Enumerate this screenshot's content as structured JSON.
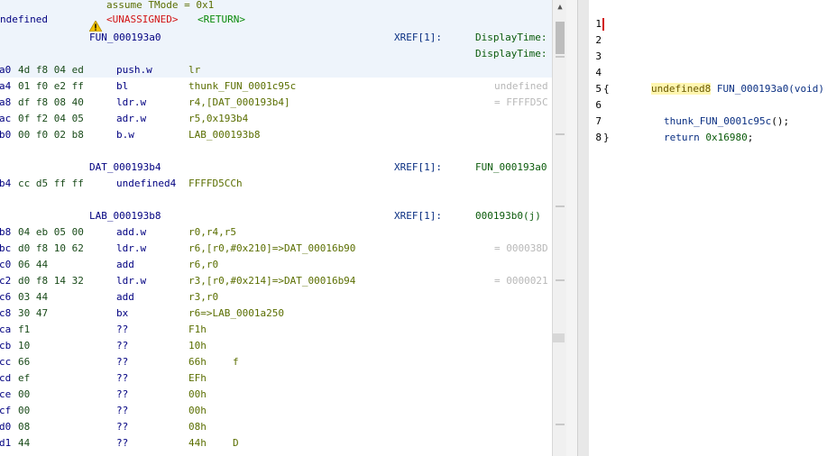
{
  "listing": {
    "header": {
      "truncated_label": "ndefined",
      "assume": "assume TMode = 0x1",
      "unassigned": "<UNASSIGNED>",
      "return": "<RETURN>",
      "func_name": "FUN_000193a0",
      "xref_label": "XREF[1]:",
      "xref_val1": "DisplayTime:",
      "xref_val2": "DisplayTime:"
    },
    "instructions": [
      {
        "addr": "a0",
        "bytes": "4d f8 04 ed",
        "mnem": "push.w",
        "ops": "lr",
        "comment": ""
      },
      {
        "addr": "a4",
        "bytes": "01 f0 e2 ff",
        "mnem": "bl",
        "ops": "thunk_FUN_0001c95c",
        "comment": "undefined"
      },
      {
        "addr": "a8",
        "bytes": "df f8 08 40",
        "mnem": "ldr.w",
        "ops": "r4,[DAT_000193b4]",
        "comment": "= FFFFD5C"
      },
      {
        "addr": "ac",
        "bytes": "0f f2 04 05",
        "mnem": "adr.w",
        "ops": "r5,0x193b4",
        "comment": ""
      },
      {
        "addr": "b0",
        "bytes": "00 f0 02 b8",
        "mnem": "b.w",
        "ops": "LAB_000193b8",
        "comment": ""
      }
    ],
    "dat_label": "DAT_000193b4",
    "dat_xref_label": "XREF[1]:",
    "dat_xref_val": "FUN_000193a0",
    "dat_line": {
      "addr": "b4",
      "bytes": "cc d5 ff ff",
      "mnem": "undefined4",
      "ops": "FFFFD5CCh"
    },
    "lab_label": "LAB_000193b8",
    "lab_xref_label": "XREF[1]:",
    "lab_xref_val": "000193b0(j)",
    "instructions2": [
      {
        "addr": "b8",
        "bytes": "04 eb 05 00",
        "mnem": "add.w",
        "ops": "r0,r4,r5",
        "comment": ""
      },
      {
        "addr": "bc",
        "bytes": "d0 f8 10 62",
        "mnem": "ldr.w",
        "ops": "r6,[r0,#0x210]=>DAT_00016b90",
        "comment": "= 000038D"
      },
      {
        "addr": "c0",
        "bytes": "06 44",
        "mnem": "add",
        "ops": "r6,r0",
        "comment": ""
      },
      {
        "addr": "c2",
        "bytes": "d0 f8 14 32",
        "mnem": "ldr.w",
        "ops": "r3,[r0,#0x214]=>DAT_00016b94",
        "comment": "= 0000021"
      },
      {
        "addr": "c6",
        "bytes": "03 44",
        "mnem": "add",
        "ops": "r3,r0",
        "comment": ""
      },
      {
        "addr": "c8",
        "bytes": "30 47",
        "mnem": "bx",
        "ops": "r6=>LAB_0001a250",
        "comment": ""
      }
    ],
    "data_bytes": [
      {
        "addr": "ca",
        "bytes": "f1",
        "mnem": "??",
        "ops": "F1h",
        "chr": ""
      },
      {
        "addr": "cb",
        "bytes": "10",
        "mnem": "??",
        "ops": "10h",
        "chr": ""
      },
      {
        "addr": "cc",
        "bytes": "66",
        "mnem": "??",
        "ops": "66h",
        "chr": "f"
      },
      {
        "addr": "cd",
        "bytes": "ef",
        "mnem": "??",
        "ops": "EFh",
        "chr": ""
      },
      {
        "addr": "ce",
        "bytes": "00",
        "mnem": "??",
        "ops": "00h",
        "chr": ""
      },
      {
        "addr": "cf",
        "bytes": "00",
        "mnem": "??",
        "ops": "00h",
        "chr": ""
      },
      {
        "addr": "d0",
        "bytes": "08",
        "mnem": "??",
        "ops": "08h",
        "chr": ""
      },
      {
        "addr": "d1",
        "bytes": "44",
        "mnem": "??",
        "ops": "44h",
        "chr": "D"
      }
    ]
  },
  "decompiler": {
    "line_numbers": [
      "1",
      "2",
      "3",
      "4",
      "5",
      "6",
      "7",
      "8"
    ],
    "signature_type": "undefined8",
    "signature_rest": " FUN_000193a0(void)",
    "open_brace": "{",
    "call_fn": "thunk_FUN_0001c95c",
    "call_rest": "();",
    "return_kw": "return ",
    "return_val": "0x16980",
    "return_end": ";",
    "close_brace": "}"
  },
  "icons": {
    "warning": "warning-icon",
    "scroll_up": "chevron-up-icon"
  },
  "colors": {
    "header_bg": "#eef4fb",
    "highlight": "#fff6b0",
    "caret": "#d21414"
  }
}
